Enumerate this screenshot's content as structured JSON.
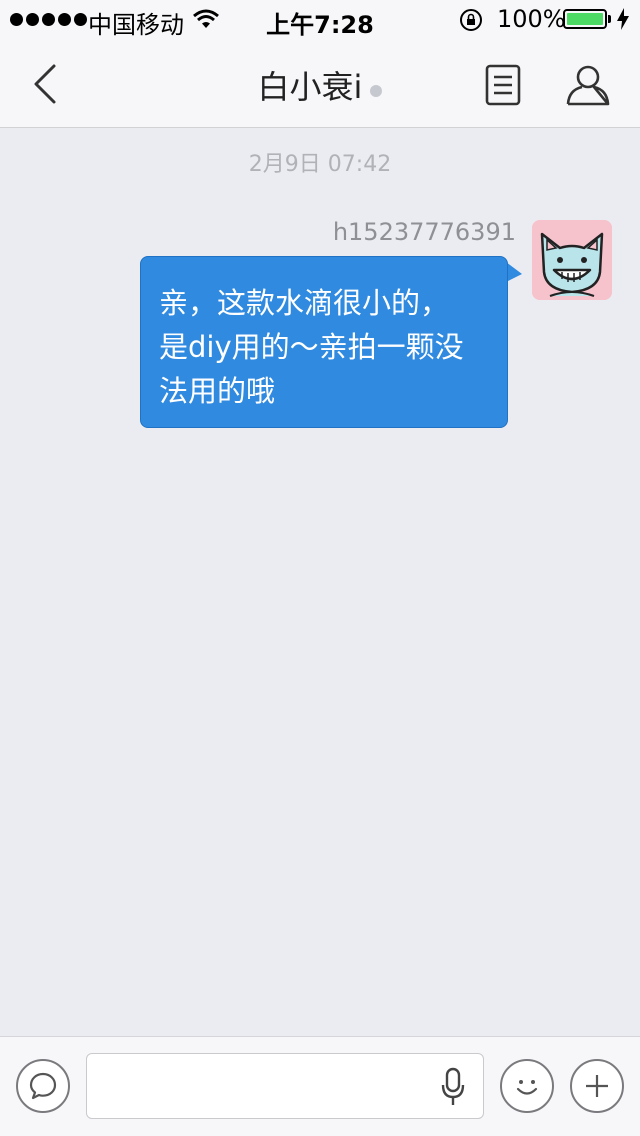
{
  "status_bar": {
    "carrier": "中国移动",
    "time": "上午7:28",
    "battery": "100%"
  },
  "nav": {
    "title": "白小衰i"
  },
  "chat": {
    "timestamp": "2月9日 07:42",
    "messages": [
      {
        "sender": "h15237776391",
        "lines": [
          "亲，这款水滴很小的，",
          "是diy用的～亲拍一颗没",
          "法用的哦"
        ]
      }
    ]
  },
  "input": {
    "value": "",
    "placeholder": ""
  },
  "icons": {
    "back": "chevron-left-icon",
    "notes": "document-icon",
    "profile": "person-icon",
    "voice": "speech-bubble-icon",
    "mic": "microphone-icon",
    "emoji": "smiley-icon",
    "plus": "plus-icon"
  },
  "colors": {
    "bubble": "#2f8ae0",
    "battery": "#4cd964",
    "background": "#ebecf1"
  }
}
